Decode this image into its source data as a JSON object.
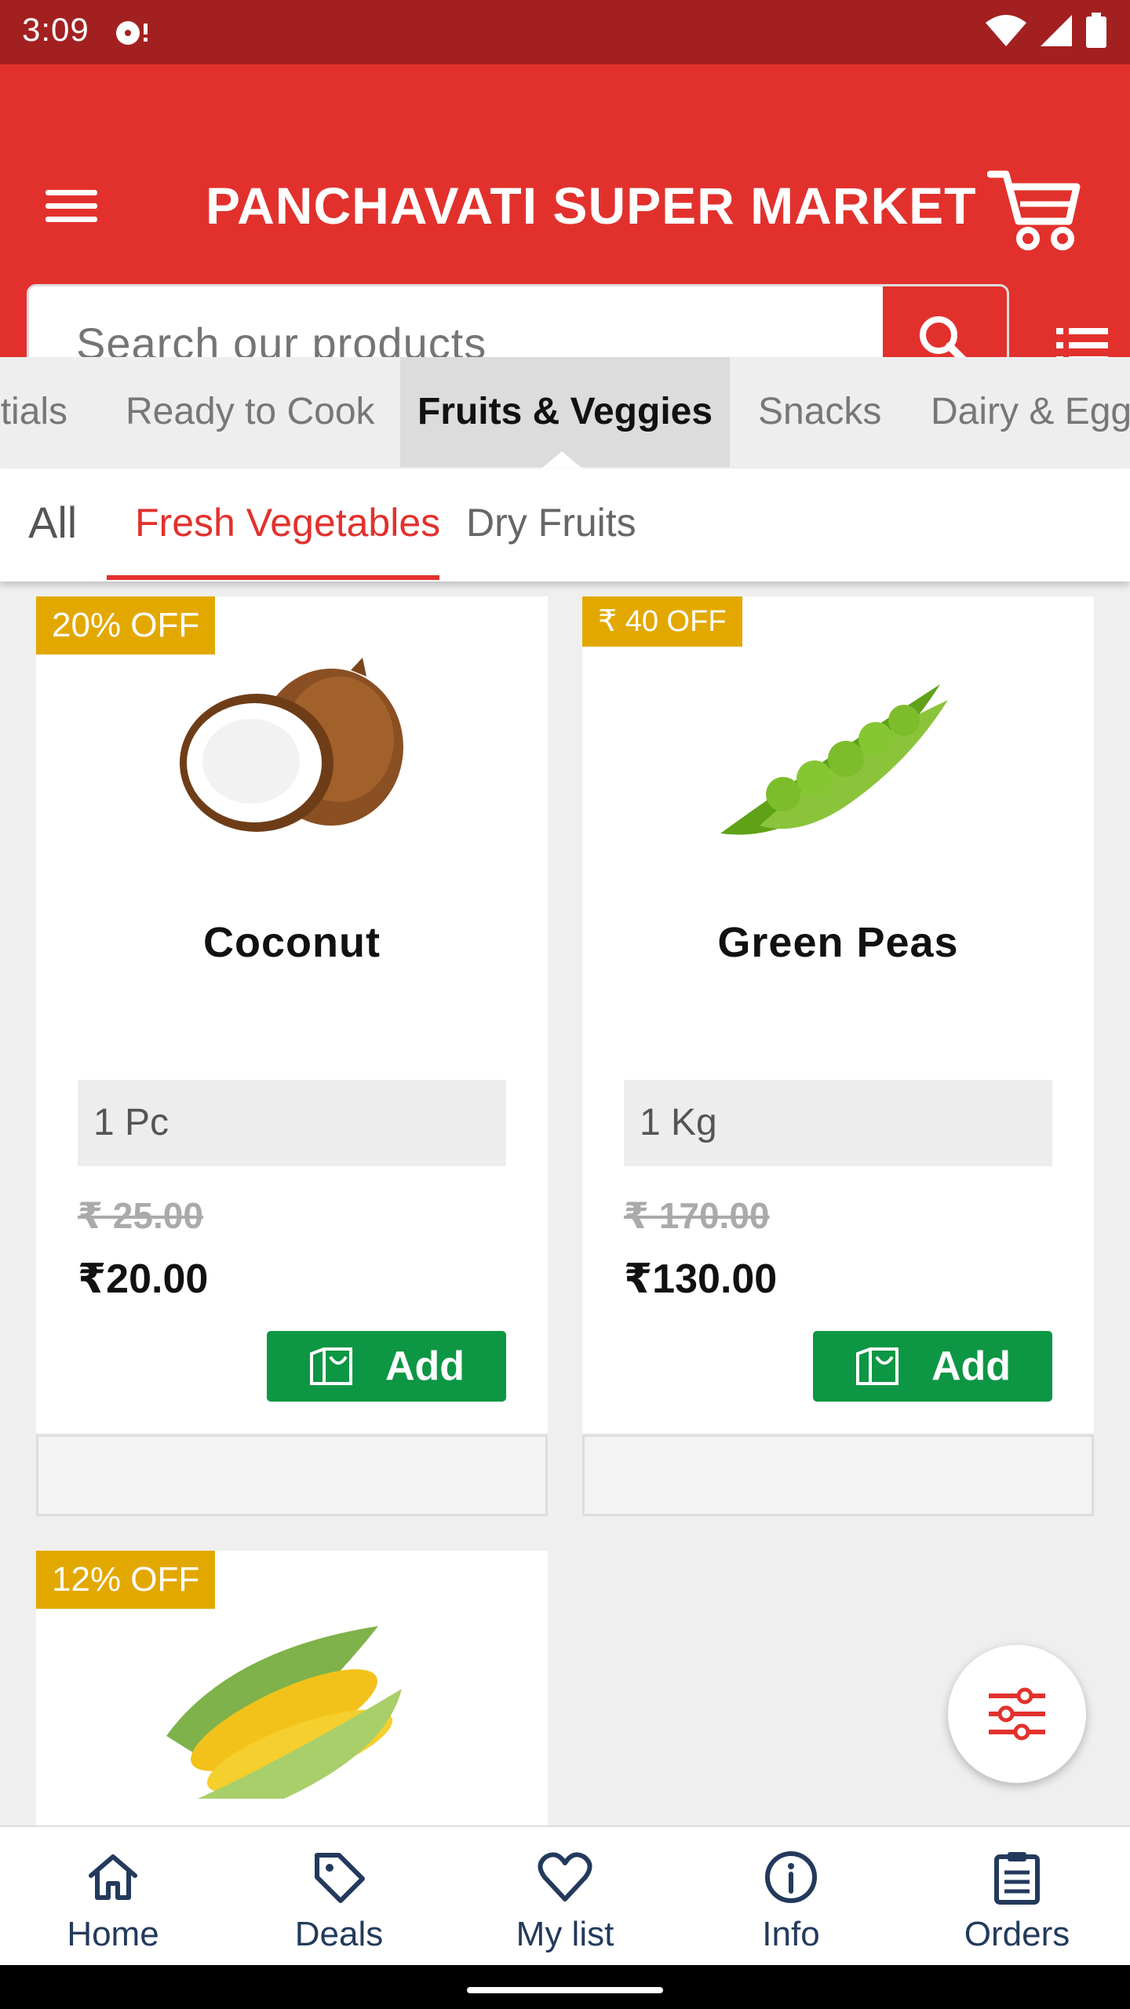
{
  "status_bar": {
    "time": "3:09"
  },
  "header": {
    "title": "PANCHAVATI SUPER MARKET"
  },
  "search": {
    "placeholder": "Search our products"
  },
  "category_tabs": [
    {
      "label": "ntials"
    },
    {
      "label": "Ready to Cook"
    },
    {
      "label": "Fruits & Veggies"
    },
    {
      "label": "Snacks"
    },
    {
      "label": "Dairy & Egg"
    }
  ],
  "sub_tabs": [
    {
      "label": "All"
    },
    {
      "label": "Fresh Vegetables"
    },
    {
      "label": "Dry Fruits"
    }
  ],
  "products": [
    {
      "badge": "20% OFF",
      "name": "Coconut",
      "quantity": "1 Pc",
      "old_price": "₹ 25.00",
      "price": "₹20.00",
      "add_label": "Add"
    },
    {
      "badge": "₹ 40 OFF",
      "name": "Green Peas",
      "quantity": "1 Kg",
      "old_price": "₹ 170.00",
      "price": "₹130.00",
      "add_label": "Add"
    },
    {
      "badge": "12% OFF"
    }
  ],
  "bottom_nav": [
    {
      "label": "Home",
      "icon": "home-icon"
    },
    {
      "label": "Deals",
      "icon": "tag-icon"
    },
    {
      "label": "My list",
      "icon": "heart-icon"
    },
    {
      "label": "Info",
      "icon": "info-icon"
    },
    {
      "label": "Orders",
      "icon": "clipboard-icon"
    }
  ],
  "colors": {
    "primary": "#e2312d",
    "status_bar": "#a32020",
    "badge": "#e3a800",
    "add_button": "#0d9644",
    "nav_text": "#233a5c"
  }
}
